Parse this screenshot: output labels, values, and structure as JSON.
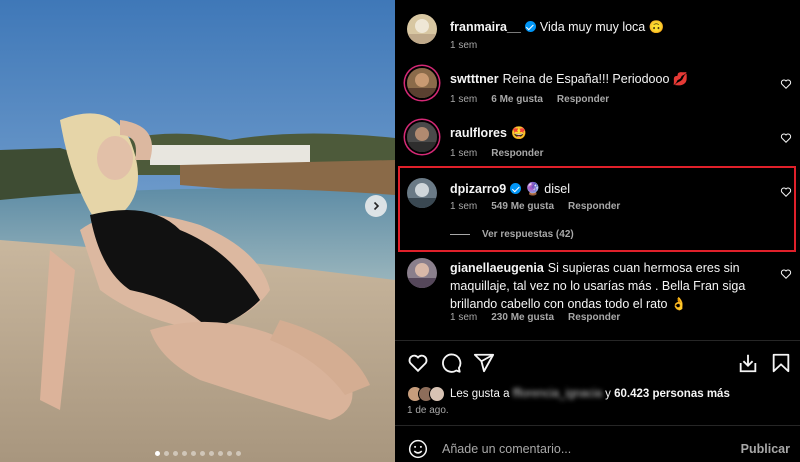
{
  "post": {
    "caption": {
      "username": "franmaira__",
      "verified": true,
      "text": "Vida muy muy loca 🙃",
      "time": "1 sem"
    }
  },
  "comments": [
    {
      "username": "swtttner",
      "text": "Reina de España!!! Periodooo 💋",
      "time": "1 sem",
      "likes": "6 Me gusta",
      "reply": "Responder"
    },
    {
      "username": "raulflores",
      "text": "🤩",
      "time": "1 sem",
      "reply": "Responder"
    },
    {
      "username": "dpizarro9",
      "verified": true,
      "text": "🔮 disel",
      "time": "1 sem",
      "likes": "549 Me gusta",
      "reply": "Responder",
      "view_replies": "Ver respuestas (42)"
    },
    {
      "username": "gianellaeugenia",
      "text": "Si supieras cuan hermosa eres sin maquillaje, tal vez no lo usarías más . Bella Fran siga brillando cabello con ondas todo el rato 👌",
      "time": "1 sem",
      "likes": "230 Me gusta",
      "reply": "Responder"
    }
  ],
  "likes_summary": {
    "prefix": "Les gusta a",
    "blurred_user": "fflorencia_ignacia",
    "suffix": "y",
    "count": "60.423 personas más"
  },
  "date": "1 de ago.",
  "add_comment": {
    "placeholder": "Añade un comentario...",
    "publish": "Publicar"
  },
  "carousel": {
    "total": 10,
    "active": 0
  },
  "colors": {
    "verified": "#0095f6",
    "highlight": "#e0202a",
    "story_ring": "#d62976"
  }
}
